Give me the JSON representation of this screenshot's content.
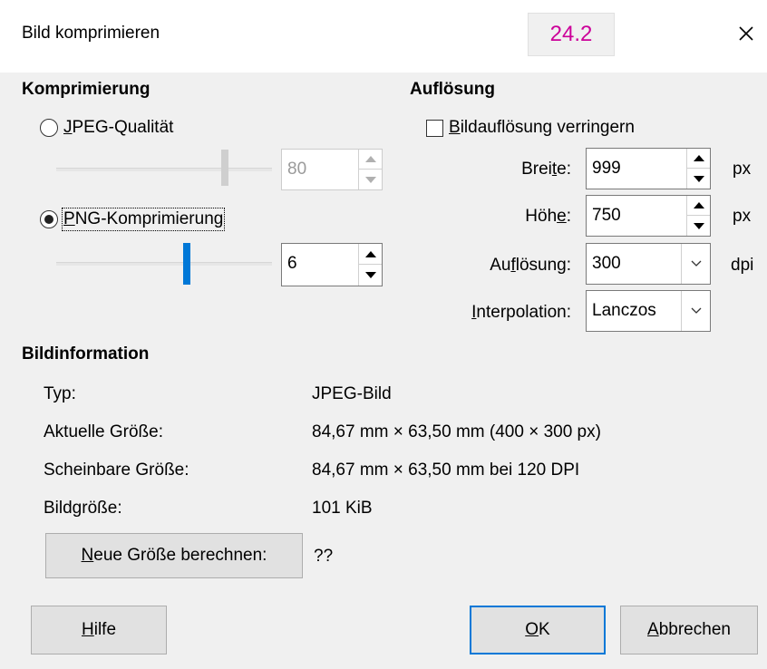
{
  "window": {
    "title": "Bild komprimieren",
    "version_badge": "24.2"
  },
  "compression": {
    "section_title": "Komprimierung",
    "jpeg_label_underline": "J",
    "jpeg_label_rest": "PEG-Qualität",
    "jpeg_value": "80",
    "jpeg_slider_level": 80,
    "png_label_underline": "P",
    "png_label_rest": "NG-Komprimierung",
    "png_value": "6",
    "png_slider_level": 6,
    "selected": "png"
  },
  "resolution": {
    "section_title": "Auflösung",
    "reduce_label_underline": "B",
    "reduce_label_rest": "ildauflösung verringern",
    "reduce_checked": false,
    "width_label_pre": "Brei",
    "width_label_u": "t",
    "width_label_post": "e:",
    "width_value": "999",
    "width_unit": "px",
    "height_label_pre": "Höh",
    "height_label_u": "e",
    "height_label_post": ":",
    "height_value": "750",
    "height_unit": "px",
    "dpi_label_pre": "Au",
    "dpi_label_u": "f",
    "dpi_label_post": "lösung:",
    "dpi_value": "300",
    "dpi_unit": "dpi",
    "interp_label_u": "I",
    "interp_label_post": "nterpolation:",
    "interp_value": "Lanczos"
  },
  "info": {
    "section_title": "Bildinformation",
    "rows": [
      {
        "label": "Typ:",
        "value": "JPEG-Bild"
      },
      {
        "label": "Aktuelle Größe:",
        "value": "84,67 mm × 63,50 mm (400 × 300 px)"
      },
      {
        "label": "Scheinbare Größe:",
        "value": "84,67 mm × 63,50 mm bei 120 DPI"
      },
      {
        "label": "Bildgröße:",
        "value": "101 KiB"
      }
    ],
    "calc_button_u": "N",
    "calc_button_rest": "eue Größe berechnen:",
    "calc_result": "??"
  },
  "buttons": {
    "help_u": "H",
    "help_rest": "ilfe",
    "ok_u": "O",
    "ok_rest": "K",
    "cancel_u": "A",
    "cancel_rest": "bbrechen"
  },
  "colors": {
    "accent": "#0078d7",
    "badge_text": "#cc0099"
  },
  "icons": {
    "close": "close-icon",
    "spin_up": "spin-up-icon",
    "spin_down": "spin-down-icon",
    "dropdown": "chevron-down-icon"
  }
}
